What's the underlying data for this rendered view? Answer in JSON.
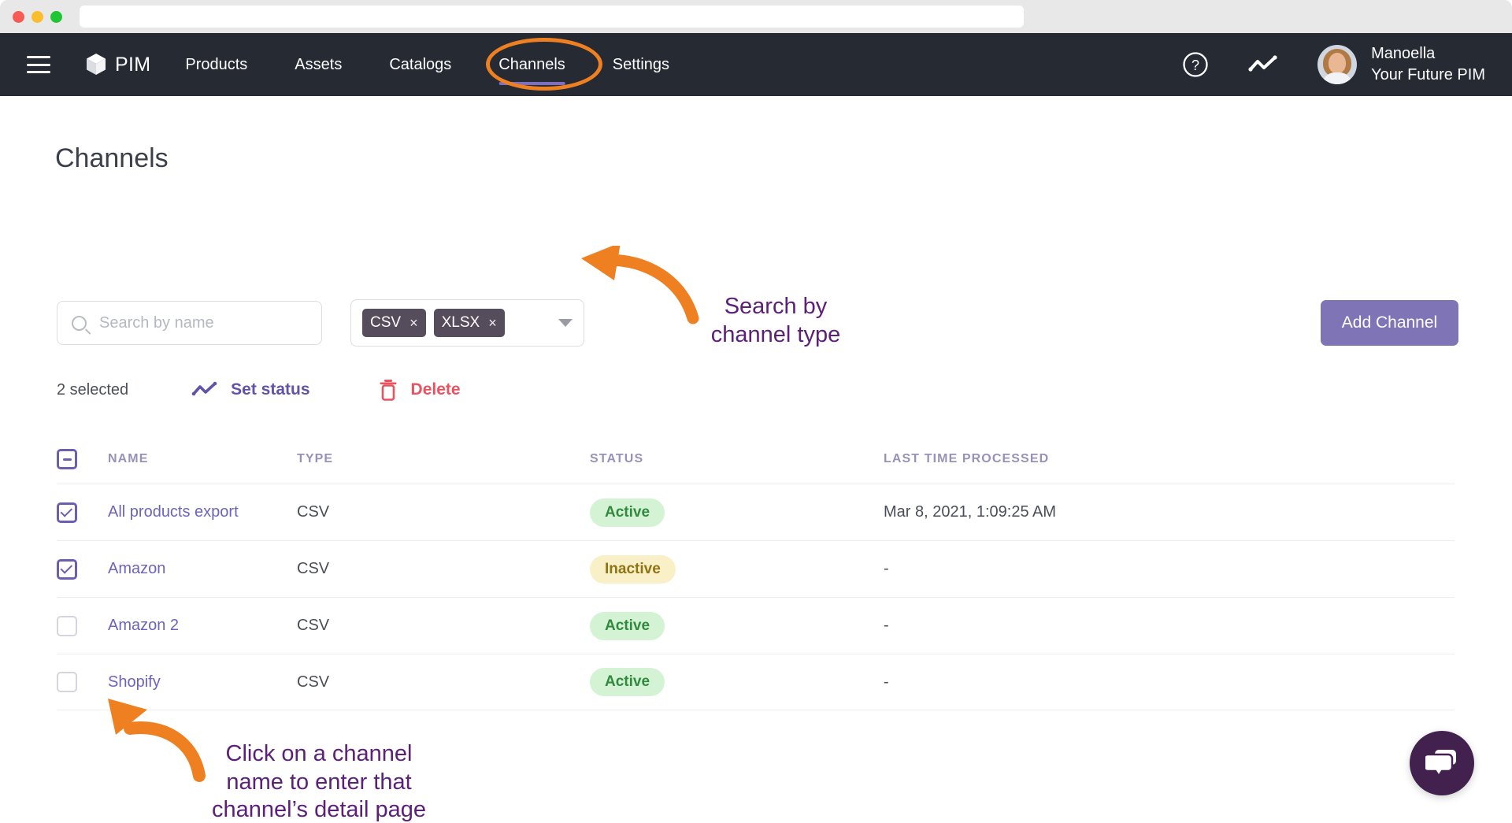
{
  "browser": {
    "traffic_lights": [
      "close-red",
      "minimize-yellow",
      "maximize-green"
    ],
    "url_value": ""
  },
  "topnav": {
    "menu_icon": "hamburger-icon",
    "brand": {
      "icon": "cube-icon",
      "label": "PIM"
    },
    "items": [
      {
        "label": "Products",
        "active": false
      },
      {
        "label": "Assets",
        "active": false
      },
      {
        "label": "Catalogs",
        "active": false
      },
      {
        "label": "Channels",
        "active": true
      },
      {
        "label": "Settings",
        "active": false
      }
    ],
    "help_icon": "question-circle-icon",
    "activity_icon": "trend-line-icon",
    "user": {
      "avatar": "user-avatar",
      "name": "Manoella",
      "org": "Your Future PIM"
    }
  },
  "page": {
    "title": "Channels",
    "search": {
      "placeholder": "Search by name",
      "value": "",
      "icon": "search-icon"
    },
    "type_filter": {
      "chips": [
        "CSV",
        "XLSX"
      ],
      "remove_glyph": "×",
      "caret_icon": "chevron-down-icon"
    },
    "add_button": "Add Channel"
  },
  "actionbar": {
    "selected_label": "2 selected",
    "set_status": {
      "label": "Set status",
      "icon": "trend-line-icon"
    },
    "delete": {
      "label": "Delete",
      "icon": "trash-icon"
    }
  },
  "table": {
    "select_all_state": "indeterminate",
    "columns": [
      "NAME",
      "TYPE",
      "STATUS",
      "LAST TIME PROCESSED"
    ],
    "rows": [
      {
        "checked": true,
        "name": "All products export",
        "type": "CSV",
        "status": "Active",
        "status_kind": "active",
        "last_time": "Mar 8, 2021, 1:09:25 AM"
      },
      {
        "checked": true,
        "name": "Amazon",
        "type": "CSV",
        "status": "Inactive",
        "status_kind": "inactive",
        "last_time": "-"
      },
      {
        "checked": false,
        "name": "Amazon 2",
        "type": "CSV",
        "status": "Active",
        "status_kind": "active",
        "last_time": "-"
      },
      {
        "checked": false,
        "name": "Shopify",
        "type": "CSV",
        "status": "Active",
        "status_kind": "active",
        "last_time": "-"
      }
    ]
  },
  "annotations": {
    "top": "Search by\nchannel type",
    "bottom": "Click on a channel\nname to enter that\nchannel’s detail page",
    "highlight_target": "Channels"
  },
  "chat": {
    "icon": "chat-bubbles-icon"
  },
  "colors": {
    "nav_bg": "#252a33",
    "accent_purple": "#7e74b6",
    "link_purple": "#6d63bd",
    "annotation_purple": "#5c2079",
    "highlight_orange": "#ef8022",
    "delete_red": "#ea5260",
    "status_active_bg": "#d4f3d5",
    "status_active_fg": "#318a3d",
    "status_inactive_bg": "#faf0c8",
    "status_inactive_fg": "#8e7414",
    "chat_bubble_bg": "#42214f"
  }
}
